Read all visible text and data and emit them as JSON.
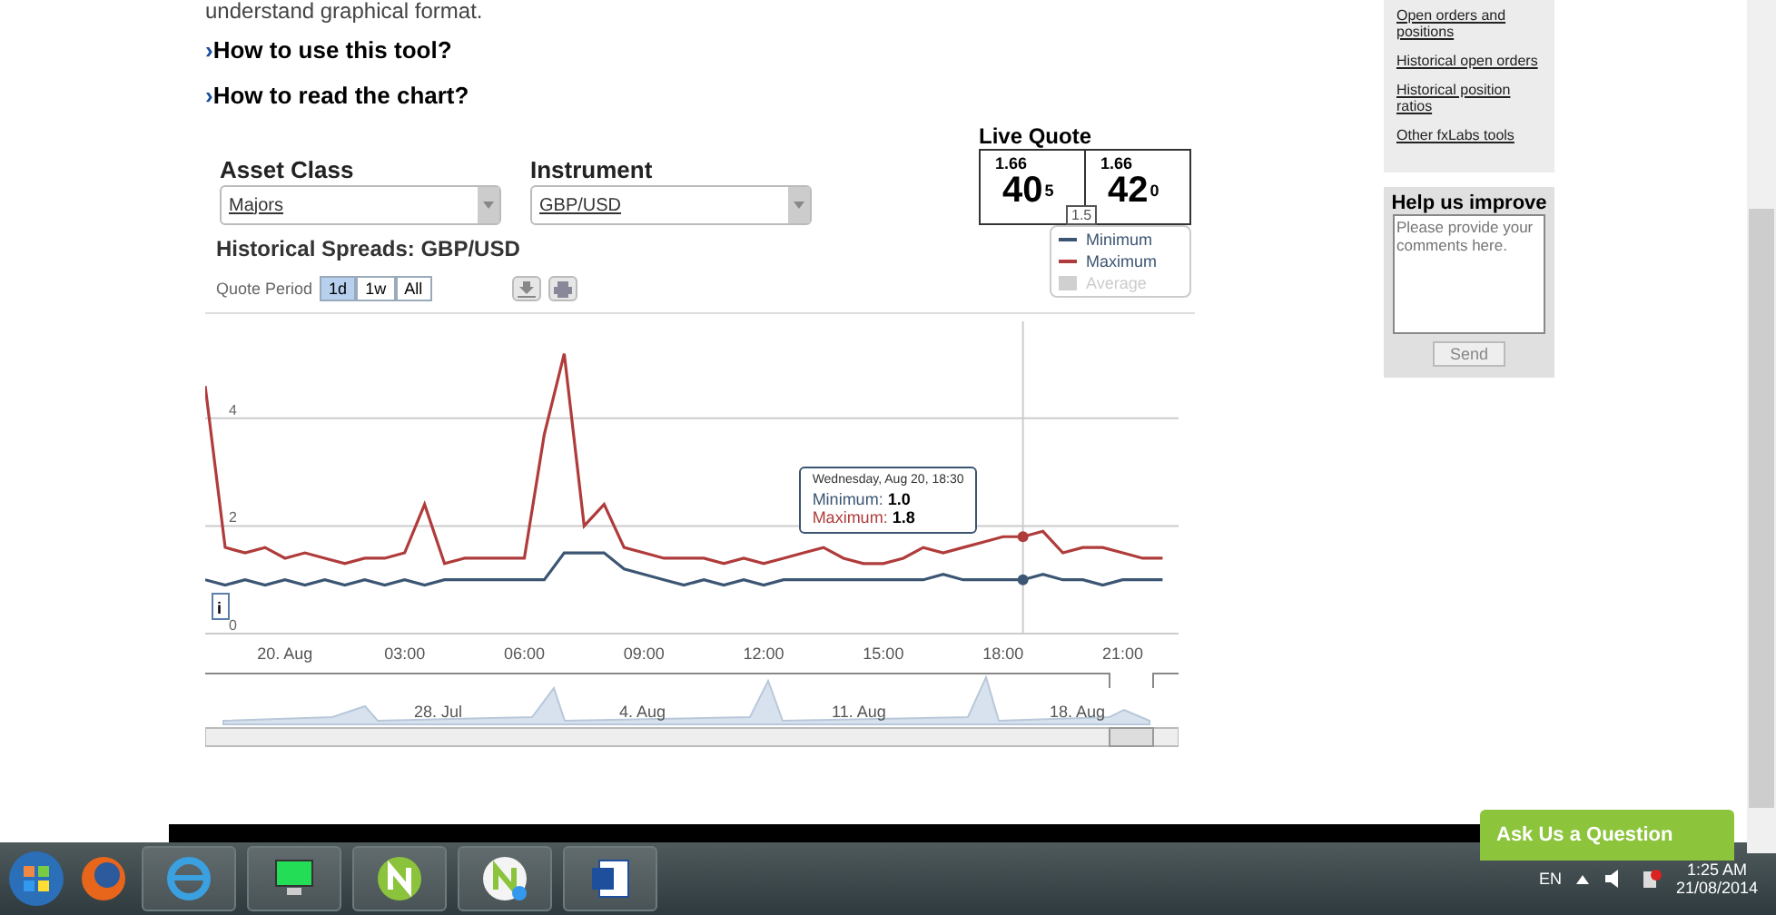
{
  "intro_text": "understand graphical format.",
  "help_links": [
    {
      "marker": "›",
      "label": "How to use this tool?"
    },
    {
      "marker": "›",
      "label": "How to read the chart?"
    }
  ],
  "asset_class": {
    "label": "Asset Class",
    "value": "Majors"
  },
  "instrument": {
    "label": "Instrument",
    "value": "GBP/USD"
  },
  "live_quote": {
    "title": "Live Quote",
    "bid": {
      "big_figure": "1.66",
      "pips": "40",
      "fraction": "5"
    },
    "ask": {
      "big_figure": "1.66",
      "pips": "42",
      "fraction": "0"
    },
    "spread": "1.5"
  },
  "chart_title": "Historical Spreads: GBP/USD",
  "quote_period": {
    "label": "Quote Period",
    "options": [
      {
        "label": "1d",
        "selected": true
      },
      {
        "label": "1w",
        "selected": false
      },
      {
        "label": "All",
        "selected": false
      }
    ]
  },
  "legend_extra": {
    "name": "Average",
    "enabled": false
  },
  "chart_data": {
    "type": "line",
    "x": [
      -2,
      -1.5,
      -1,
      -0.5,
      0,
      0.5,
      1,
      1.5,
      2,
      2.5,
      3,
      3.5,
      4,
      4.5,
      5,
      5.5,
      6,
      6.5,
      7,
      7.5,
      8,
      8.5,
      9,
      9.5,
      10,
      10.5,
      11,
      11.5,
      12,
      12.5,
      13,
      13.5,
      14,
      14.5,
      15,
      15.5,
      16,
      16.5,
      17,
      17.5,
      18,
      18.5,
      19,
      19.5,
      20,
      20.5,
      21,
      21.5,
      22
    ],
    "series": [
      {
        "name": "Minimum",
        "color": "#3b5573",
        "values": [
          1.0,
          0.9,
          1.0,
          0.9,
          1.0,
          0.9,
          1.0,
          0.9,
          1.0,
          0.9,
          1.0,
          0.9,
          1.0,
          1.0,
          1.0,
          1.0,
          1.0,
          1.0,
          1.5,
          1.5,
          1.5,
          1.2,
          1.1,
          1.0,
          0.9,
          1.0,
          0.9,
          1.0,
          0.9,
          1.0,
          1.0,
          1.0,
          1.0,
          1.0,
          1.0,
          1.0,
          1.0,
          1.1,
          1.0,
          1.0,
          1.0,
          1.0,
          1.1,
          1.0,
          1.0,
          0.9,
          1.0,
          1.0,
          1.0
        ]
      },
      {
        "name": "Maximum",
        "color": "#b03b3b",
        "values": [
          4.6,
          1.6,
          1.5,
          1.6,
          1.4,
          1.5,
          1.4,
          1.3,
          1.4,
          1.4,
          1.5,
          2.4,
          1.3,
          1.4,
          1.4,
          1.4,
          1.4,
          3.7,
          5.2,
          2.0,
          2.4,
          1.6,
          1.5,
          1.4,
          1.4,
          1.4,
          1.3,
          1.4,
          1.3,
          1.4,
          1.5,
          1.6,
          1.4,
          1.3,
          1.3,
          1.4,
          1.6,
          1.5,
          1.6,
          1.7,
          1.8,
          1.8,
          1.9,
          1.5,
          1.6,
          1.6,
          1.5,
          1.4,
          1.4
        ]
      }
    ],
    "xlim": [
      -2,
      22.4
    ],
    "ylim": [
      0,
      5.8
    ],
    "xticks": [
      {
        "value": 0,
        "label": "20. Aug"
      },
      {
        "value": 3,
        "label": "03:00"
      },
      {
        "value": 6,
        "label": "06:00"
      },
      {
        "value": 9,
        "label": "09:00"
      },
      {
        "value": 12,
        "label": "12:00"
      },
      {
        "value": 15,
        "label": "15:00"
      },
      {
        "value": 18,
        "label": "18:00"
      },
      {
        "value": 21,
        "label": "21:00"
      }
    ],
    "yticks": [
      0,
      2,
      4
    ],
    "annotations": [
      "i"
    ]
  },
  "tooltip": {
    "title": "Wednesday, Aug 20, 18:30",
    "rows": [
      {
        "label": "Minimum:",
        "value": "1.0",
        "color": "#3b5573"
      },
      {
        "label": "Maximum:",
        "value": "1.8",
        "color": "#b03b3b"
      }
    ]
  },
  "navigator": {
    "labels": [
      "28. Jul",
      "4. Aug",
      "11. Aug",
      "18. Aug"
    ]
  },
  "sidebar": {
    "links": [
      "Open orders and positions",
      "Historical open orders",
      "Historical position ratios",
      "Other fxLabs tools"
    ]
  },
  "feedback": {
    "title": "Help us improve",
    "placeholder": "Please provide your comments here.",
    "button": "Send"
  },
  "ask_button": "Ask Us a Question",
  "taskbar": {
    "language": "EN",
    "time": "1:25 AM",
    "date": "21/08/2014"
  }
}
